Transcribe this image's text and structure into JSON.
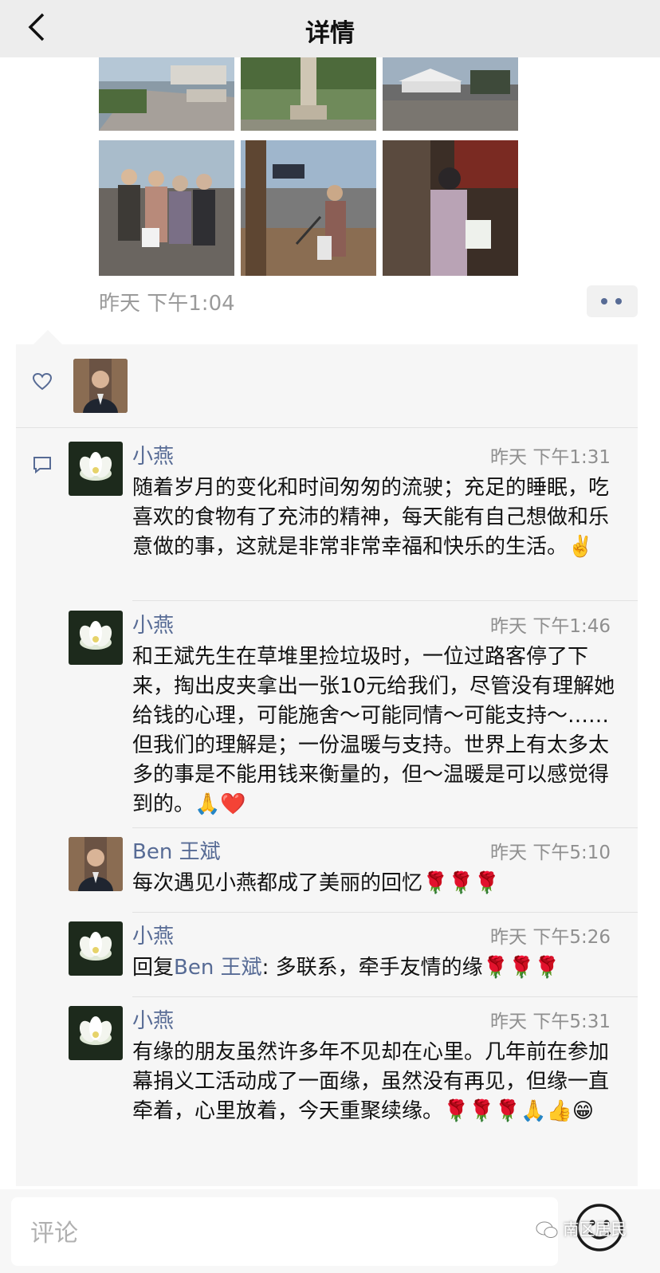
{
  "nav": {
    "title": "详情"
  },
  "post": {
    "time": "昨天 下午1:04",
    "photos": [
      "street-plaza-photo",
      "monument-photo",
      "market-tents-photo",
      "group-volunteers-photo",
      "litter-picking-photo",
      "woman-with-bag-photo"
    ]
  },
  "likes": {
    "avatars": [
      "Ben 王斌"
    ]
  },
  "comments": [
    {
      "name": "小燕",
      "time": "昨天 下午1:31",
      "text": "随着岁月的变化和时间匆匆的流驶；充足的睡眠，吃喜欢的食物有了充沛的精神，每天能有自己想做和乐意做的事，这就是非常非常幸福和快乐的生活。✌️"
    },
    {
      "name": "小燕",
      "time": "昨天 下午1:46",
      "text": "和王斌先生在草堆里捡垃圾时，一位过路客停了下来，掏出皮夹拿出一张10元给我们，尽管没有理解她给钱的心理，可能施舍～可能同情～可能支持～……但我们的理解是；一份温暖与支持。世界上有太多太多的事是不能用钱来衡量的，但～温暖是可以感觉得到的。🙏❤️"
    },
    {
      "name": "Ben 王斌",
      "time": "昨天 下午5:10",
      "text": "每次遇见小燕都成了美丽的回忆🌹🌹🌹"
    },
    {
      "name": "小燕",
      "time": "昨天 下午5:26",
      "reply_prefix": "回复",
      "reply_to": "Ben 王斌",
      "text": ": 多联系，牵手友情的缘🌹🌹🌹"
    },
    {
      "name": "小燕",
      "time": "昨天 下午5:31",
      "text": "有缘的朋友虽然许多年不见却在心里。几年前在参加幕捐义工活动成了一面缘，虽然没有再见，但缘一直牵着，心里放着，今天重聚续缘。🌹🌹🌹🙏👍😁"
    }
  ],
  "input": {
    "placeholder": "评论"
  },
  "watermark": "南区居民",
  "colors": {
    "link": "#576b95",
    "panel": "#f6f6f6",
    "nav": "#ededed"
  }
}
